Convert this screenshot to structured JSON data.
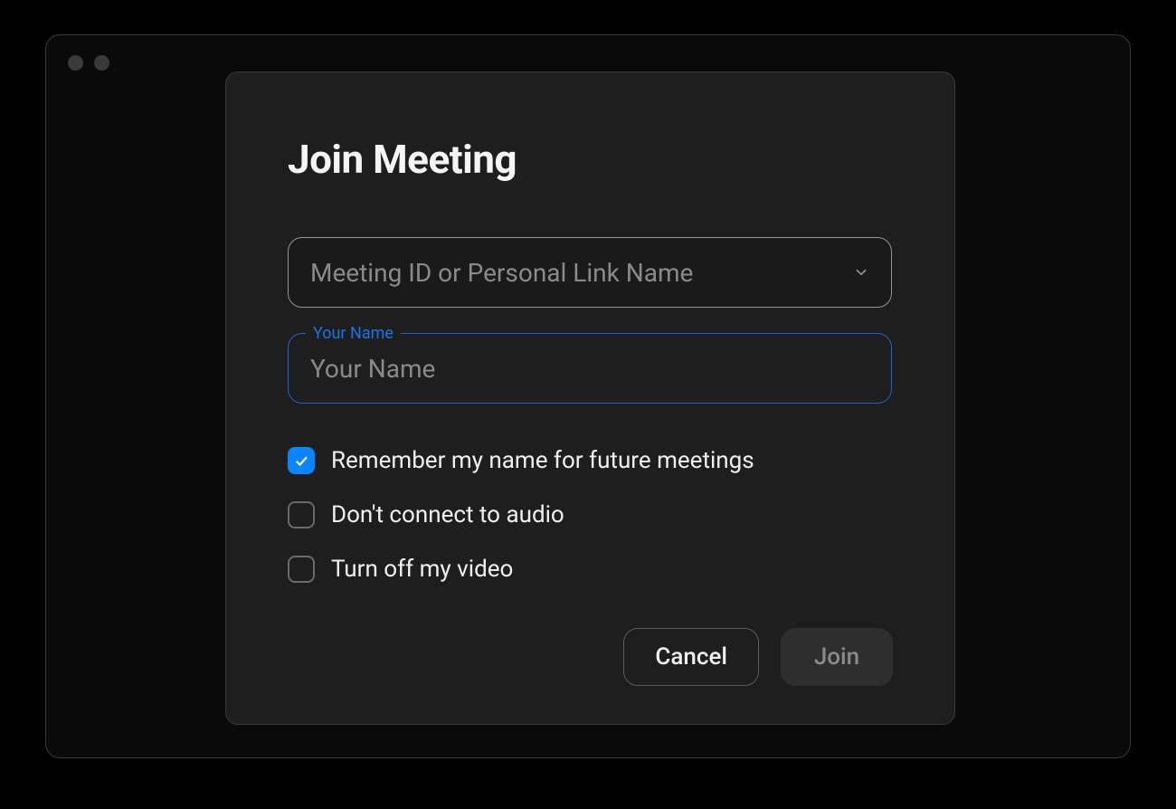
{
  "dialog": {
    "title": "Join Meeting",
    "meeting_id_placeholder": "Meeting ID or Personal Link Name",
    "meeting_id_value": "",
    "name_label": "Your Name",
    "name_placeholder": "Your Name",
    "name_value": "",
    "options": [
      {
        "label": "Remember my name for future meetings",
        "checked": true
      },
      {
        "label": "Don't connect to audio",
        "checked": false
      },
      {
        "label": "Turn off my video",
        "checked": false
      }
    ],
    "buttons": {
      "cancel": "Cancel",
      "join": "Join"
    }
  }
}
